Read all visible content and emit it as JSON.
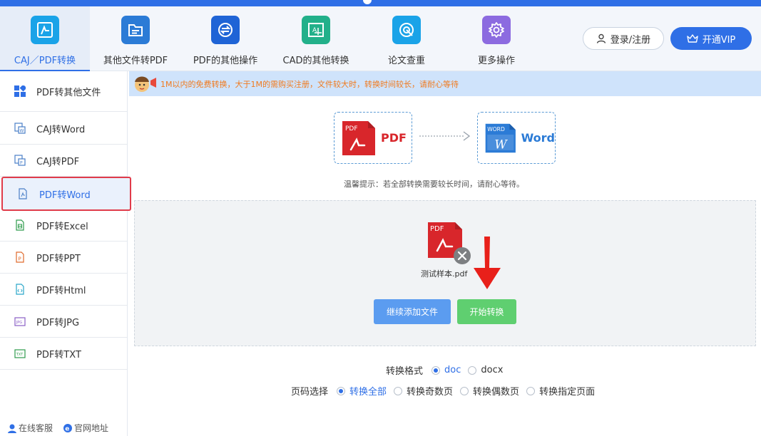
{
  "colors": {
    "accent": "#2f6fe6",
    "pdf_red": "#d8262b",
    "word_blue": "#2b7bd6",
    "start_green": "#5fcf70",
    "add_blue": "#5b9cf0",
    "notice_orange": "#f07a1e"
  },
  "toolbar": {
    "tabs": [
      {
        "label": "CAJ／PDF转换",
        "icon": "caj-pdf-icon",
        "color": "#1aa3e8",
        "active": true
      },
      {
        "label": "其他文件转PDF",
        "icon": "folder-icon",
        "color": "#2b7bd6"
      },
      {
        "label": "PDF的其他操作",
        "icon": "swap-icon",
        "color": "#1f64d6"
      },
      {
        "label": "CAD的其他转换",
        "icon": "cad-icon",
        "color": "#22b08a"
      },
      {
        "label": "论文查重",
        "icon": "target-icon",
        "color": "#1aa3e8"
      },
      {
        "label": "更多操作",
        "icon": "gear-icon",
        "color": "#8c6be0"
      }
    ],
    "login_label": "登录/注册",
    "vip_label": "开通VIP"
  },
  "sidebar": {
    "items": [
      {
        "label": "PDF转其他文件",
        "icon": "grid-icon"
      },
      {
        "label": "CAJ转Word",
        "icon": "caj-word-icon"
      },
      {
        "label": "CAJ转PDF",
        "icon": "caj-pdf-small-icon"
      },
      {
        "label": "PDF转Word",
        "icon": "pdf-file-icon",
        "active": true
      },
      {
        "label": "PDF转Excel",
        "icon": "excel-file-icon"
      },
      {
        "label": "PDF转PPT",
        "icon": "ppt-file-icon"
      },
      {
        "label": "PDF转Html",
        "icon": "html-file-icon"
      },
      {
        "label": "PDF转JPG",
        "icon": "jpg-file-icon"
      },
      {
        "label": "PDF转TXT",
        "icon": "txt-file-icon"
      }
    ],
    "footer": {
      "service_label": "在线客服",
      "site_label": "官网地址"
    }
  },
  "notice": {
    "text": "1M以内的免费转换，大于1M的需购买注册，文件较大时，转换时间较长，请耐心等待"
  },
  "conversion": {
    "from": {
      "badge": "PDF",
      "name": "PDF"
    },
    "to": {
      "badge": "WORD",
      "name": "Word"
    },
    "tip": "温馨提示：若全部转换需要较长时间，请耐心等待。"
  },
  "file": {
    "badge": "PDF",
    "name": "测试样本.pdf"
  },
  "buttons": {
    "add_more": "继续添加文件",
    "start": "开始转换"
  },
  "options": {
    "format": {
      "label": "转换格式",
      "choices": [
        "doc",
        "docx"
      ],
      "selected": "doc"
    },
    "pages": {
      "label": "页码选择",
      "choices": [
        "转换全部",
        "转换奇数页",
        "转换偶数页",
        "转换指定页面"
      ],
      "selected": "转换全部"
    }
  }
}
